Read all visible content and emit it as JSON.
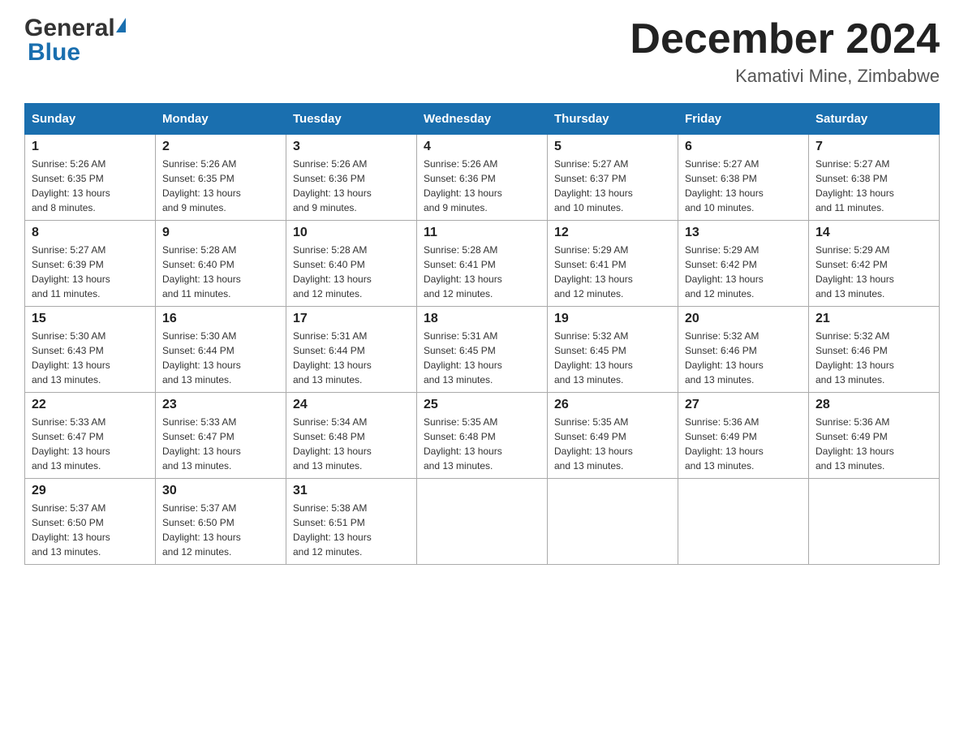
{
  "header": {
    "logo_general": "General",
    "logo_blue": "Blue",
    "month_title": "December 2024",
    "location": "Kamativi Mine, Zimbabwe"
  },
  "days_of_week": [
    "Sunday",
    "Monday",
    "Tuesday",
    "Wednesday",
    "Thursday",
    "Friday",
    "Saturday"
  ],
  "weeks": [
    [
      {
        "day": "1",
        "sunrise": "5:26 AM",
        "sunset": "6:35 PM",
        "daylight": "13 hours and 8 minutes."
      },
      {
        "day": "2",
        "sunrise": "5:26 AM",
        "sunset": "6:35 PM",
        "daylight": "13 hours and 9 minutes."
      },
      {
        "day": "3",
        "sunrise": "5:26 AM",
        "sunset": "6:36 PM",
        "daylight": "13 hours and 9 minutes."
      },
      {
        "day": "4",
        "sunrise": "5:26 AM",
        "sunset": "6:36 PM",
        "daylight": "13 hours and 9 minutes."
      },
      {
        "day": "5",
        "sunrise": "5:27 AM",
        "sunset": "6:37 PM",
        "daylight": "13 hours and 10 minutes."
      },
      {
        "day": "6",
        "sunrise": "5:27 AM",
        "sunset": "6:38 PM",
        "daylight": "13 hours and 10 minutes."
      },
      {
        "day": "7",
        "sunrise": "5:27 AM",
        "sunset": "6:38 PM",
        "daylight": "13 hours and 11 minutes."
      }
    ],
    [
      {
        "day": "8",
        "sunrise": "5:27 AM",
        "sunset": "6:39 PM",
        "daylight": "13 hours and 11 minutes."
      },
      {
        "day": "9",
        "sunrise": "5:28 AM",
        "sunset": "6:40 PM",
        "daylight": "13 hours and 11 minutes."
      },
      {
        "day": "10",
        "sunrise": "5:28 AM",
        "sunset": "6:40 PM",
        "daylight": "13 hours and 12 minutes."
      },
      {
        "day": "11",
        "sunrise": "5:28 AM",
        "sunset": "6:41 PM",
        "daylight": "13 hours and 12 minutes."
      },
      {
        "day": "12",
        "sunrise": "5:29 AM",
        "sunset": "6:41 PM",
        "daylight": "13 hours and 12 minutes."
      },
      {
        "day": "13",
        "sunrise": "5:29 AM",
        "sunset": "6:42 PM",
        "daylight": "13 hours and 12 minutes."
      },
      {
        "day": "14",
        "sunrise": "5:29 AM",
        "sunset": "6:42 PM",
        "daylight": "13 hours and 13 minutes."
      }
    ],
    [
      {
        "day": "15",
        "sunrise": "5:30 AM",
        "sunset": "6:43 PM",
        "daylight": "13 hours and 13 minutes."
      },
      {
        "day": "16",
        "sunrise": "5:30 AM",
        "sunset": "6:44 PM",
        "daylight": "13 hours and 13 minutes."
      },
      {
        "day": "17",
        "sunrise": "5:31 AM",
        "sunset": "6:44 PM",
        "daylight": "13 hours and 13 minutes."
      },
      {
        "day": "18",
        "sunrise": "5:31 AM",
        "sunset": "6:45 PM",
        "daylight": "13 hours and 13 minutes."
      },
      {
        "day": "19",
        "sunrise": "5:32 AM",
        "sunset": "6:45 PM",
        "daylight": "13 hours and 13 minutes."
      },
      {
        "day": "20",
        "sunrise": "5:32 AM",
        "sunset": "6:46 PM",
        "daylight": "13 hours and 13 minutes."
      },
      {
        "day": "21",
        "sunrise": "5:32 AM",
        "sunset": "6:46 PM",
        "daylight": "13 hours and 13 minutes."
      }
    ],
    [
      {
        "day": "22",
        "sunrise": "5:33 AM",
        "sunset": "6:47 PM",
        "daylight": "13 hours and 13 minutes."
      },
      {
        "day": "23",
        "sunrise": "5:33 AM",
        "sunset": "6:47 PM",
        "daylight": "13 hours and 13 minutes."
      },
      {
        "day": "24",
        "sunrise": "5:34 AM",
        "sunset": "6:48 PM",
        "daylight": "13 hours and 13 minutes."
      },
      {
        "day": "25",
        "sunrise": "5:35 AM",
        "sunset": "6:48 PM",
        "daylight": "13 hours and 13 minutes."
      },
      {
        "day": "26",
        "sunrise": "5:35 AM",
        "sunset": "6:49 PM",
        "daylight": "13 hours and 13 minutes."
      },
      {
        "day": "27",
        "sunrise": "5:36 AM",
        "sunset": "6:49 PM",
        "daylight": "13 hours and 13 minutes."
      },
      {
        "day": "28",
        "sunrise": "5:36 AM",
        "sunset": "6:49 PM",
        "daylight": "13 hours and 13 minutes."
      }
    ],
    [
      {
        "day": "29",
        "sunrise": "5:37 AM",
        "sunset": "6:50 PM",
        "daylight": "13 hours and 13 minutes."
      },
      {
        "day": "30",
        "sunrise": "5:37 AM",
        "sunset": "6:50 PM",
        "daylight": "13 hours and 12 minutes."
      },
      {
        "day": "31",
        "sunrise": "5:38 AM",
        "sunset": "6:51 PM",
        "daylight": "13 hours and 12 minutes."
      },
      null,
      null,
      null,
      null
    ]
  ],
  "labels": {
    "sunrise": "Sunrise:",
    "sunset": "Sunset:",
    "daylight": "Daylight:"
  }
}
